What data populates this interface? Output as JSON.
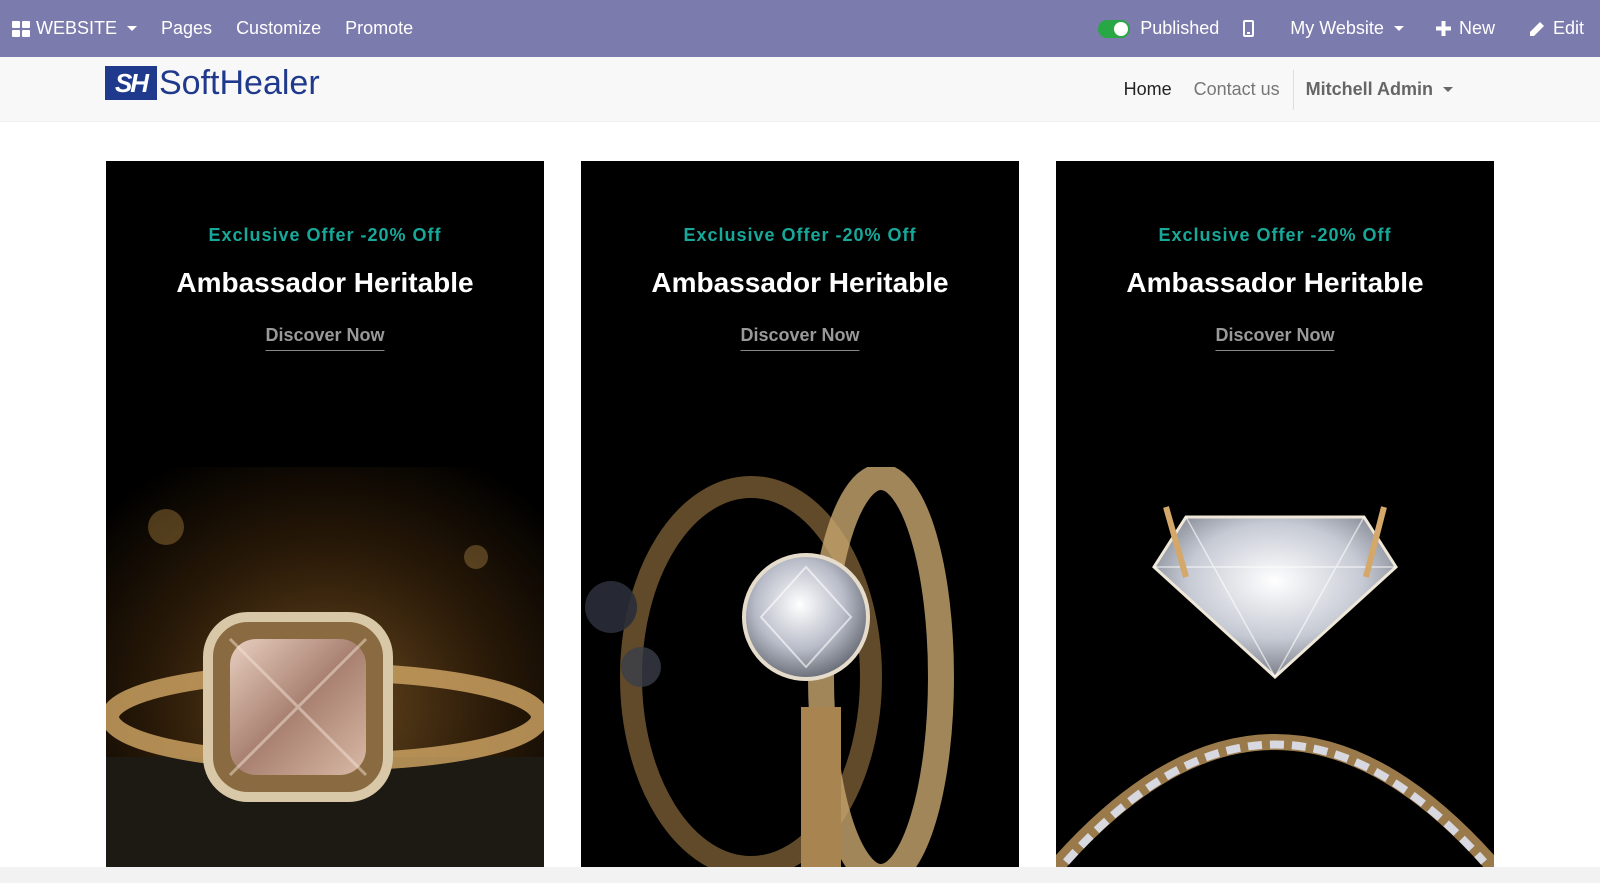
{
  "admin_bar": {
    "app_label": "WEBSITE",
    "menu": [
      "Pages",
      "Customize",
      "Promote"
    ],
    "published_label": "Published",
    "website_label": "My Website",
    "new_label": "New",
    "edit_label": "Edit",
    "icons": {
      "apps": "apps-grid-icon",
      "toggle": "toggle-on-icon",
      "mobile": "mobile-icon",
      "new": "plus-icon",
      "edit": "pencil-icon"
    },
    "colors": {
      "background": "#7c7bad",
      "toggle": "#28a745"
    }
  },
  "site_header": {
    "logo": {
      "mark": "SH",
      "text": "SoftHealer"
    },
    "nav": [
      "Home",
      "Contact us"
    ],
    "user_label": "Mitchell Admin"
  },
  "cards": [
    {
      "offer": "Exclusive Offer -20% Off",
      "title": "Ambassador Heritable",
      "link": "Discover Now"
    },
    {
      "offer": "Exclusive Offer -20% Off",
      "title": "Ambassador Heritable",
      "link": "Discover Now"
    },
    {
      "offer": "Exclusive Offer -20% Off",
      "title": "Ambassador Heritable",
      "link": "Discover Now"
    }
  ],
  "colors": {
    "offer_accent": "#17a89a",
    "brand": "#1f3a8c"
  }
}
